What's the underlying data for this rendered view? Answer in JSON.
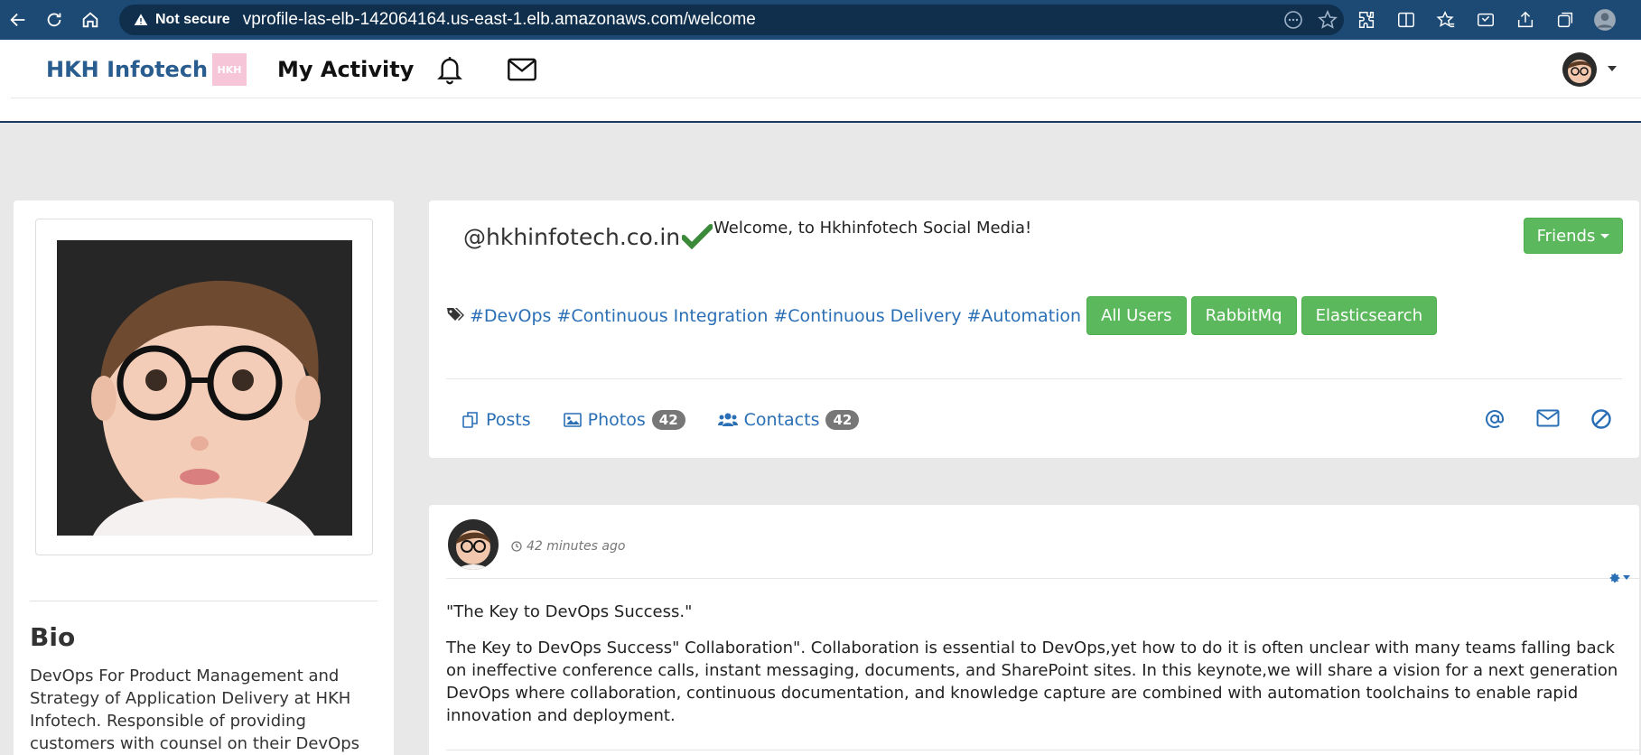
{
  "browser": {
    "security_label": "Not secure",
    "url": "vprofile-las-elb-142064164.us-east-1.elb.amazonaws.com/welcome"
  },
  "nav": {
    "brand": "HKH Infotech",
    "logo_text": "HKH",
    "my_activity": "My Activity"
  },
  "profile": {
    "bio_title": "Bio",
    "bio_text": "DevOps For Product Management and Strategy of Application Delivery at HKH Infotech. Responsible of providing customers with counsel on their DevOps"
  },
  "header": {
    "handle": "@hkhinfotech.co.in",
    "welcome": "Welcome, to Hkhinfotech Social Media!",
    "friends_label": "Friends",
    "tags": [
      "#DevOps",
      "#Continuous Integration",
      "#Continuous Delivery",
      "#Automation"
    ],
    "tag_buttons": [
      "All Users",
      "RabbitMq",
      "Elasticsearch"
    ],
    "tabs": [
      {
        "label": "Posts",
        "count": null
      },
      {
        "label": "Photos",
        "count": "42"
      },
      {
        "label": "Contacts",
        "count": "42"
      }
    ]
  },
  "post": {
    "time": "42 minutes ago",
    "quote": "\"The Key to DevOps Success.\"",
    "body": "The Key to DevOps Success\" Collaboration\". Collaboration is essential to DevOps,yet how to do it is often unclear with many teams falling back on ineffective conference calls, instant messaging, documents, and SharePoint sites. In this keynote,we will share a vision for a next generation DevOps where collaboration, continuous documentation, and knowledge capture are combined with automation toolchains to enable rapid innovation and deployment."
  },
  "colors": {
    "browser_bar": "#1c4a74",
    "brand": "#2a5d8f",
    "link": "#2a6fb5",
    "success": "#5cb85c",
    "badge": "#777777"
  }
}
